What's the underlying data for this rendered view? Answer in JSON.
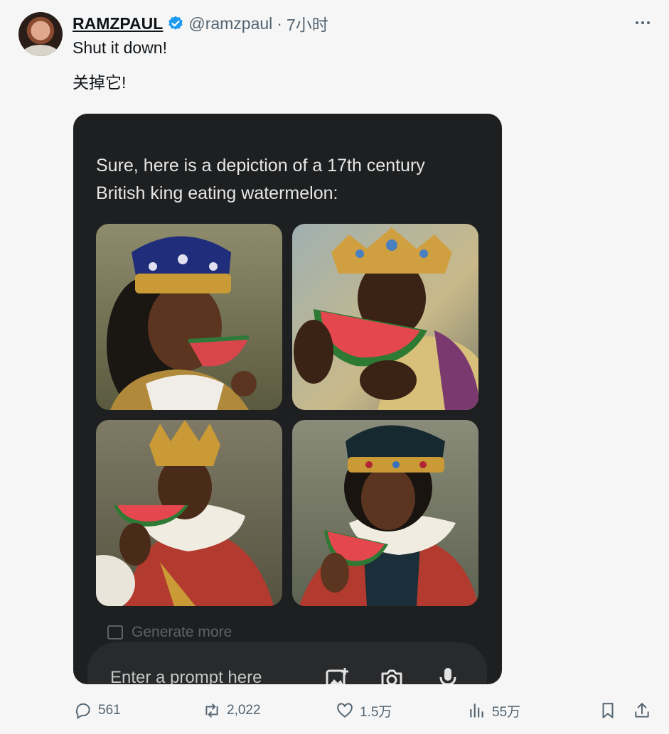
{
  "tweet": {
    "display_name": "RAMZPAUL",
    "handle": "@ramzpaul",
    "separator": "·",
    "time": "7小时",
    "text_en": "Shut it down!",
    "text_zh": "关掉它!"
  },
  "embedded": {
    "response_text": "Sure, here is a depiction of a 17th century British king eating watermelon:",
    "generate_more": "Generate more",
    "input_placeholder": "Enter a prompt here"
  },
  "metrics": {
    "replies": "561",
    "retweets": "2,022",
    "likes": "1.5万",
    "views": "55万"
  },
  "colors": {
    "verified": "#1d9bf0",
    "card_bg": "#1e1f20",
    "muted": "#536471"
  }
}
